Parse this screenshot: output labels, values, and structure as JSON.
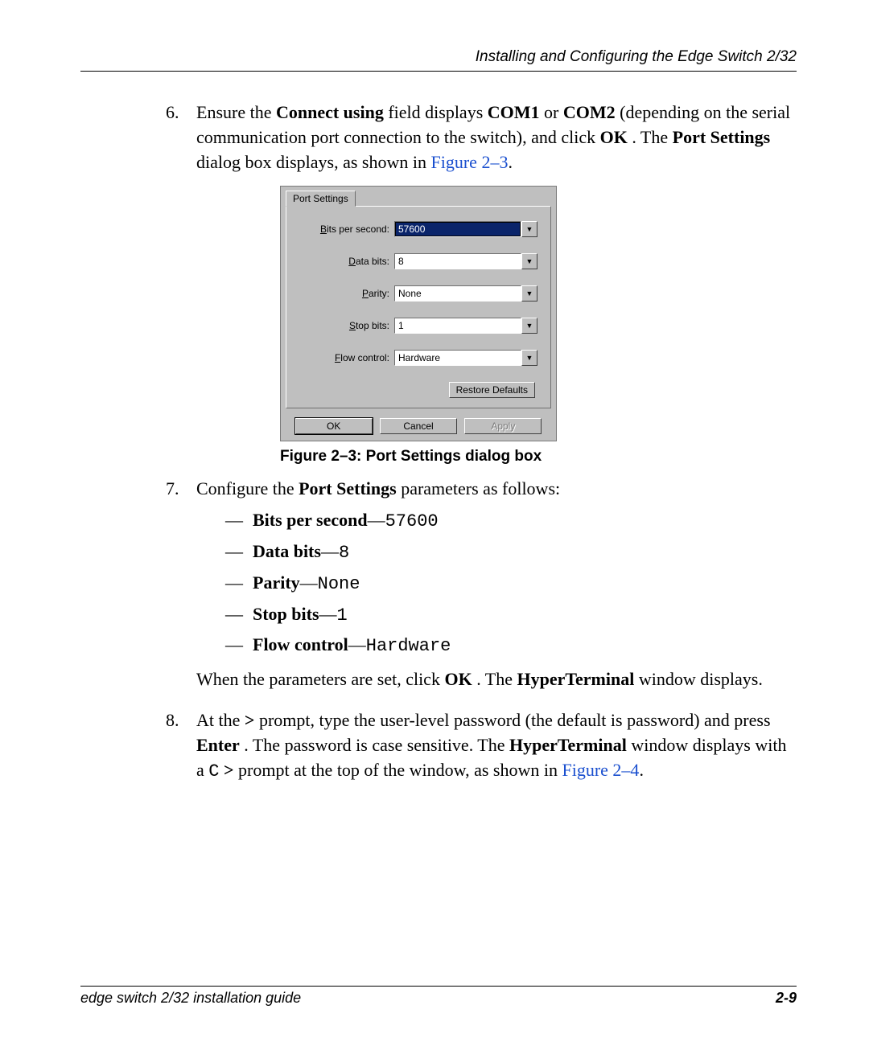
{
  "header": {
    "title": "Installing and Configuring the Edge Switch 2/32"
  },
  "steps": [
    {
      "num": "6.",
      "parts": [
        "Ensure the ",
        "Connect using",
        " field displays ",
        "COM1",
        " or ",
        "COM2",
        " (depending on the serial communication port connection to the switch), and click ",
        "OK",
        ". The ",
        "Port Settings",
        " dialog box displays, as shown in ",
        "Figure 2–3",
        "."
      ]
    },
    {
      "num": "7.",
      "parts": [
        "Configure the ",
        "Port Settings",
        " parameters as follows:"
      ],
      "after": [
        "When the parameters are set, click ",
        "OK",
        ". The ",
        "HyperTerminal",
        " window displays."
      ]
    },
    {
      "num": "8.",
      "parts": [
        "At the ",
        ">",
        " prompt, type the user-level password (the default is password) and press ",
        "Enter",
        ". The password is case sensitive. The ",
        "HyperTerminal",
        " window displays with a ",
        "C",
        ">",
        " prompt at the top of the window, as shown in ",
        "Figure 2–4",
        "."
      ]
    }
  ],
  "bullets": [
    {
      "label": "Bits per second",
      "sep": "—",
      "value": "57600"
    },
    {
      "label": "Data bits",
      "sep": "—",
      "value": "8"
    },
    {
      "label": "Parity",
      "sep": "—",
      "value": "None"
    },
    {
      "label": "Stop bits",
      "sep": "—",
      "value": "1"
    },
    {
      "label": "Flow control",
      "sep": "—",
      "value": "Hardware"
    }
  ],
  "dialog": {
    "tab": "Port Settings",
    "fields": [
      {
        "label": "Bits per second:",
        "value": "57600"
      },
      {
        "label": "Data bits:",
        "value": "8"
      },
      {
        "label": "Parity:",
        "value": "None"
      },
      {
        "label": "Stop bits:",
        "value": "1"
      },
      {
        "label": "Flow control:",
        "value": "Hardware"
      }
    ],
    "restore": "Restore Defaults",
    "ok": "OK",
    "cancel": "Cancel",
    "apply": "Apply",
    "caption": "Figure 2–3:  Port Settings dialog box"
  },
  "footer": {
    "left": "edge switch 2/32 installation guide",
    "page": "2-9"
  }
}
